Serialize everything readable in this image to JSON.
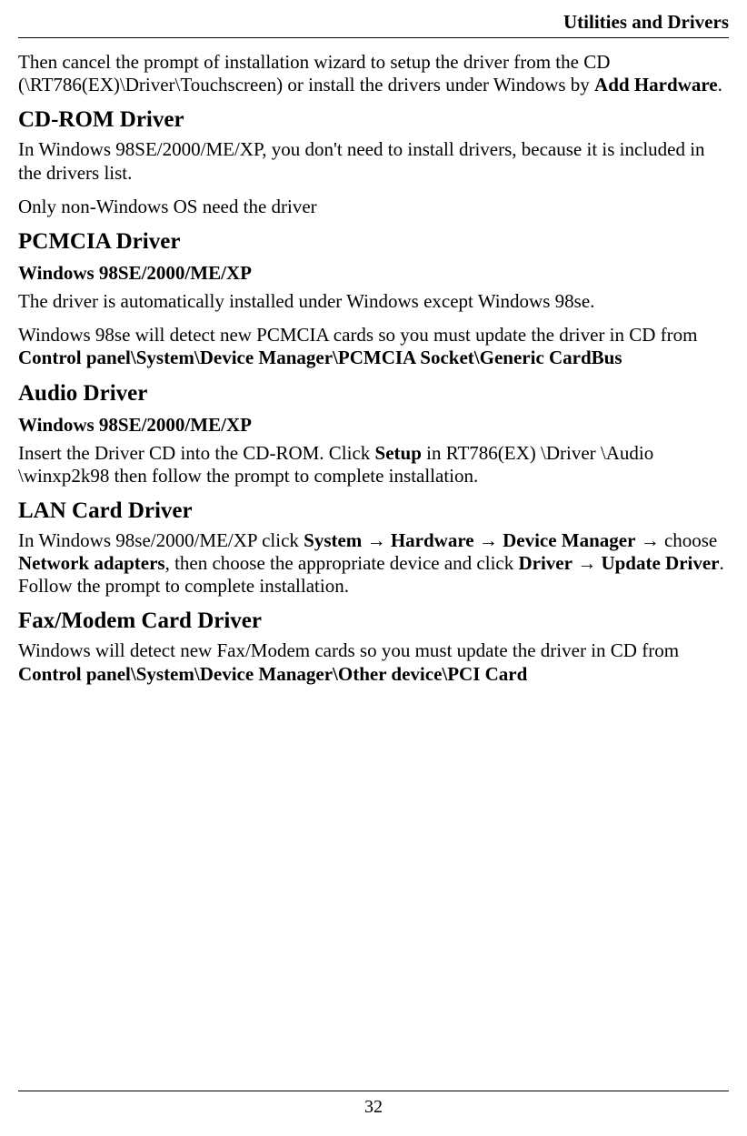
{
  "header": {
    "title": "Utilities and Drivers"
  },
  "intro": {
    "part1": "Then cancel the prompt of installation wizard to setup the driver from the CD (\\RT786(EX)\\Driver\\Touchscreen) or install the drivers under Windows by ",
    "bold1": "Add Hardware",
    "part2": "."
  },
  "cdrom": {
    "heading": "CD-ROM Driver",
    "p1": "In Windows 98SE/2000/ME/XP, you don't need to install drivers, because it is included in the drivers list.",
    "p2": "Only non-Windows OS need the driver"
  },
  "pcmcia": {
    "heading": "PCMCIA Driver",
    "subheading": "Windows 98SE/2000/ME/XP",
    "p1": "The driver is automatically installed under Windows except Windows 98se.",
    "p2a": "Windows 98se will detect new PCMCIA cards so you must update the driver in CD from ",
    "p2b": "Control panel\\System\\Device Manager\\PCMCIA Socket\\Generic CardBus"
  },
  "audio": {
    "heading": "Audio Driver",
    "subheading": "Windows 98SE/2000/ME/XP",
    "p1a": "Insert the Driver CD into the CD-ROM. Click ",
    "p1b": "Setup",
    "p1c": " in RT786(EX) \\Driver \\Audio \\winxp2k98 then follow the prompt to complete installation."
  },
  "lan": {
    "heading": "LAN Card Driver",
    "p1a": "In Windows 98se/2000/ME/XP click ",
    "p1b": "System",
    "arrow": " → ",
    "p1c": "Hardware",
    "p1d": "Device Manager",
    "p1e": " choose ",
    "p1f": "Network adapters",
    "p1g": ", then choose the appropriate device and click ",
    "p1h": "Driver",
    "p1i": "Update Driver",
    "p1j": ". Follow the prompt to complete installation."
  },
  "fax": {
    "heading": "Fax/Modem Card Driver",
    "p1a": "Windows will detect new Fax/Modem cards so you must update the driver in CD from ",
    "p1b": "Control panel\\System\\Device Manager\\Other device\\PCI Card"
  },
  "footer": {
    "page_number": "32"
  }
}
